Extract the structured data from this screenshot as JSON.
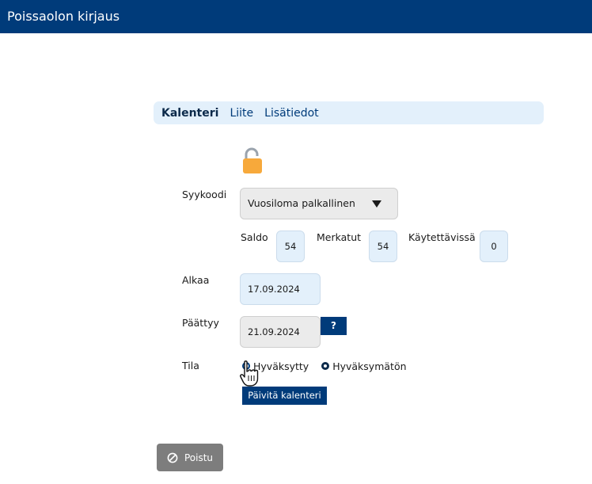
{
  "app": {
    "title": "Poissaolon kirjaus"
  },
  "tabs": [
    {
      "label": "Kalenteri",
      "active": true
    },
    {
      "label": "Liite",
      "active": false
    },
    {
      "label": "Lisätiedot",
      "active": false
    }
  ],
  "form": {
    "lock_icon": "unlocked-padlock-icon",
    "reason_code": {
      "label": "Syykoodi",
      "selected": "Vuosiloma palkallinen"
    },
    "balances": [
      {
        "label": "Saldo",
        "value": "54"
      },
      {
        "label": "Merkatut",
        "value": "54"
      },
      {
        "label": "Käytettävissä",
        "value": "0"
      }
    ],
    "start": {
      "label": "Alkaa",
      "value": "17.09.2024"
    },
    "end": {
      "label": "Päättyy",
      "value": "21.09.2024",
      "help_label": "?"
    },
    "status": {
      "label": "Tila",
      "options": [
        {
          "label": "Hyväksytty",
          "selected": false
        },
        {
          "label": "Hyväksymätön",
          "selected": true
        }
      ]
    },
    "update_button": "Päivitä kalenteri"
  },
  "footer": {
    "exit_button": "Poistu",
    "exit_icon": "ban-icon"
  },
  "colors": {
    "primary": "#003b7a",
    "light_blue": "#e3f0fb",
    "lock_orange": "#f7a93b",
    "gray_button": "#7d7d7d"
  }
}
